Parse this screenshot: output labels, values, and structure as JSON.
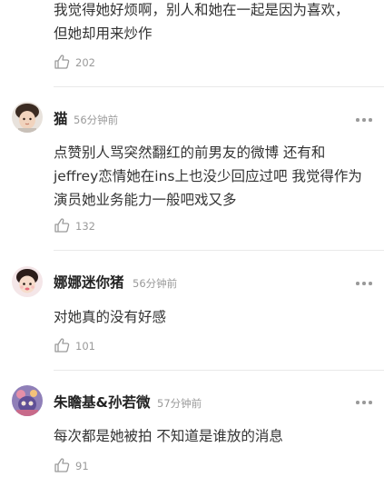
{
  "comments": [
    {
      "username": "",
      "time": "",
      "text_lines": [
        "我觉得她好烦啊，别人和她在一起是因为喜欢，",
        "但她却用来炒作"
      ],
      "likes": "202"
    },
    {
      "username": "猫",
      "time": "56分钟前",
      "text_lines": [
        "点赞别人骂突然翻红的前男友的微博 还有和",
        "jeffrey恋情她在ins上也没少回应过吧 我觉得作为",
        "演员她业务能力一般吧戏又多"
      ],
      "likes": "132"
    },
    {
      "username": "娜娜迷你猪",
      "time": "56分钟前",
      "text_lines": [
        "对她真的没有好感"
      ],
      "likes": "101"
    },
    {
      "username": "朱瞻基&孙若微",
      "time": "57分钟前",
      "text_lines": [
        "每次都是她被拍 不知道是谁放的消息"
      ],
      "likes": "91"
    }
  ],
  "colors": {
    "username": "#222222",
    "text": "#333333",
    "meta": "#9a9a9a",
    "divider": "#e9e9e9"
  },
  "icons": {
    "like": "thumbs-up-icon",
    "more": "more-dots-icon",
    "avatar": "user-avatar"
  }
}
